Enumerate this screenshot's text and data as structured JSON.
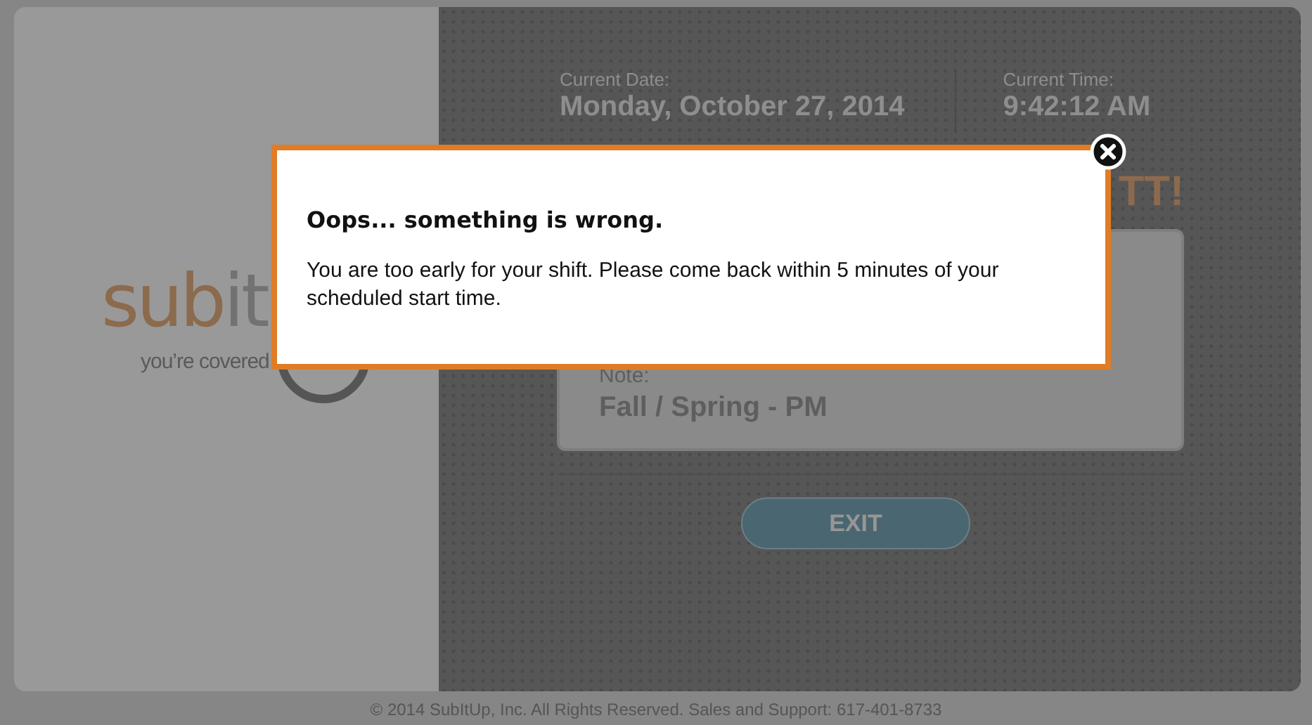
{
  "logo": {
    "wordmark_parts": [
      "sub",
      "it"
    ],
    "tagline": "you’re covered"
  },
  "date": {
    "label": "Current Date:",
    "value": "Monday, October 27, 2014"
  },
  "time": {
    "label": "Current Time:",
    "value": "9:42:12 AM"
  },
  "heading": "TT!",
  "note": {
    "label": "Note:",
    "value": "Fall / Spring - PM"
  },
  "exit_button": "EXIT",
  "footer": "© 2014 SubItUp, Inc. All Rights Reserved. Sales and Support: 617-401-8733",
  "dialog": {
    "title": "Oops... something is wrong.",
    "message": "You are too early for your shift. Please come back within 5 minutes of your scheduled start time."
  }
}
